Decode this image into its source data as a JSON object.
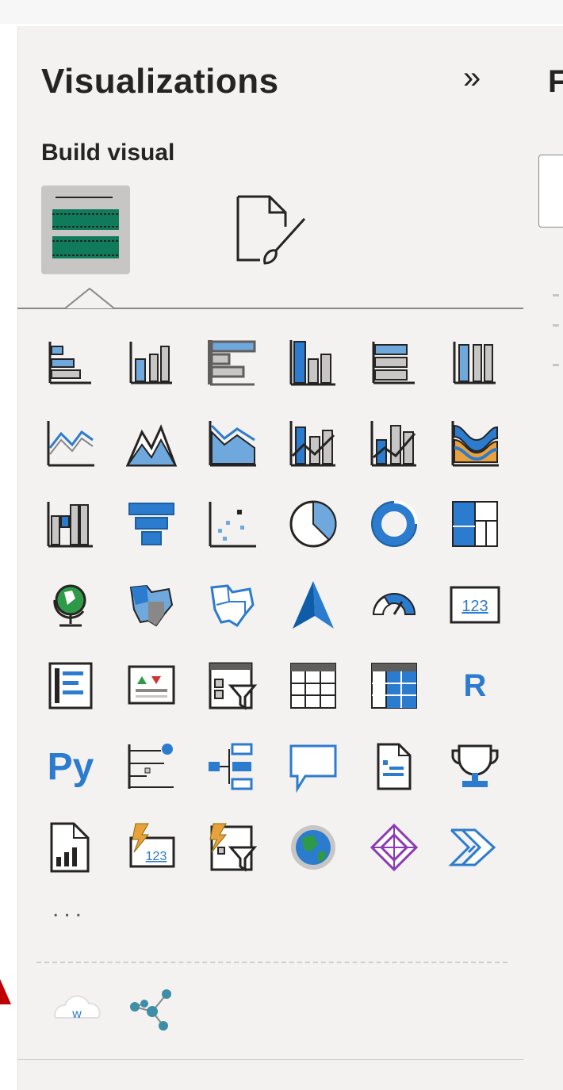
{
  "panel": {
    "title": "Visualizations",
    "collapse_glyph": "»",
    "subtitle": "Build visual",
    "more_label": "...",
    "right_glyph": "F",
    "r_label": "R",
    "py_label": "Py",
    "w_label": "w",
    "gauge_label": "123"
  },
  "tabs": [
    {
      "name": "build-visual-tab",
      "icon": "table-fields-icon",
      "selected": true
    },
    {
      "name": "format-visual-tab",
      "icon": "format-page-brush-icon",
      "selected": false
    }
  ],
  "visuals": [
    "stacked-bar-chart-icon",
    "stacked-column-chart-icon",
    "clustered-bar-chart-icon",
    "clustered-column-chart-icon",
    "100-stacked-bar-chart-icon",
    "100-stacked-column-chart-icon",
    "line-chart-icon",
    "area-chart-icon",
    "stacked-area-chart-icon",
    "line-and-stacked-column-chart-icon",
    "line-and-clustered-column-chart-icon",
    "ribbon-chart-icon",
    "waterfall-chart-icon",
    "funnel-icon",
    "scatter-chart-icon",
    "pie-chart-icon",
    "donut-chart-icon",
    "treemap-icon",
    "map-icon",
    "filled-map-icon",
    "shape-map-icon",
    "azure-map-icon",
    "gauge-icon",
    "card-icon",
    "multi-row-card-icon",
    "kpi-icon",
    "slicer-icon",
    "table-icon",
    "matrix-icon",
    "r-script-visual-icon",
    "python-visual-icon",
    "key-influencers-icon",
    "decomposition-tree-icon",
    "qa-icon",
    "smart-narrative-icon",
    "goals-icon",
    "paginated-report-icon",
    "power-apps-card-icon",
    "power-apps-slicer-icon",
    "arcgis-map-icon",
    "power-apps-icon",
    "power-automate-icon"
  ],
  "custom_visuals": [
    "word-cloud-icon",
    "network-graph-icon"
  ],
  "colors": {
    "accent_blue": "#2b7bcf",
    "light_blue": "#6fa8dc",
    "green": "#0f7b5a",
    "gray": "#8a8886",
    "panel_bg": "#f3f2f1",
    "arrow_red": "#c00000"
  }
}
